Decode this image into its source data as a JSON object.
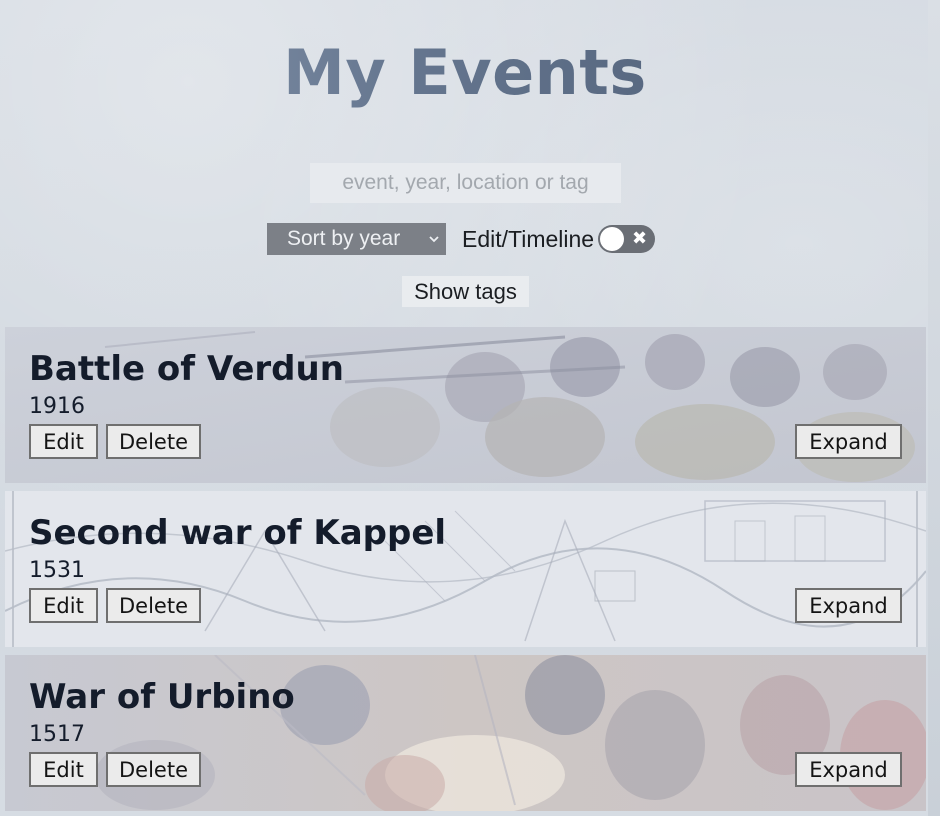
{
  "header": {
    "title": "My Events"
  },
  "search": {
    "placeholder": "event, year, location or tag",
    "value": ""
  },
  "controls": {
    "sort_selected": "Sort by year",
    "toggle_label": "Edit/Timeline",
    "toggle_on": false,
    "toggle_icon": "close-icon",
    "show_tags_label": "Show tags"
  },
  "events": [
    {
      "title": "Battle of Verdun",
      "year": "1916",
      "edit_label": "Edit",
      "delete_label": "Delete",
      "expand_label": "Expand"
    },
    {
      "title": "Second war of Kappel",
      "year": "1531",
      "edit_label": "Edit",
      "delete_label": "Delete",
      "expand_label": "Expand"
    },
    {
      "title": "War of Urbino",
      "year": "1517",
      "edit_label": "Edit",
      "delete_label": "Delete",
      "expand_label": "Expand"
    }
  ],
  "colors": {
    "title_gradient_start": "#8e9db3",
    "title_gradient_end": "#4a5a72",
    "select_bg": "#7c8087",
    "toggle_bg": "#6a6e75",
    "event_title": "#141c2b"
  }
}
